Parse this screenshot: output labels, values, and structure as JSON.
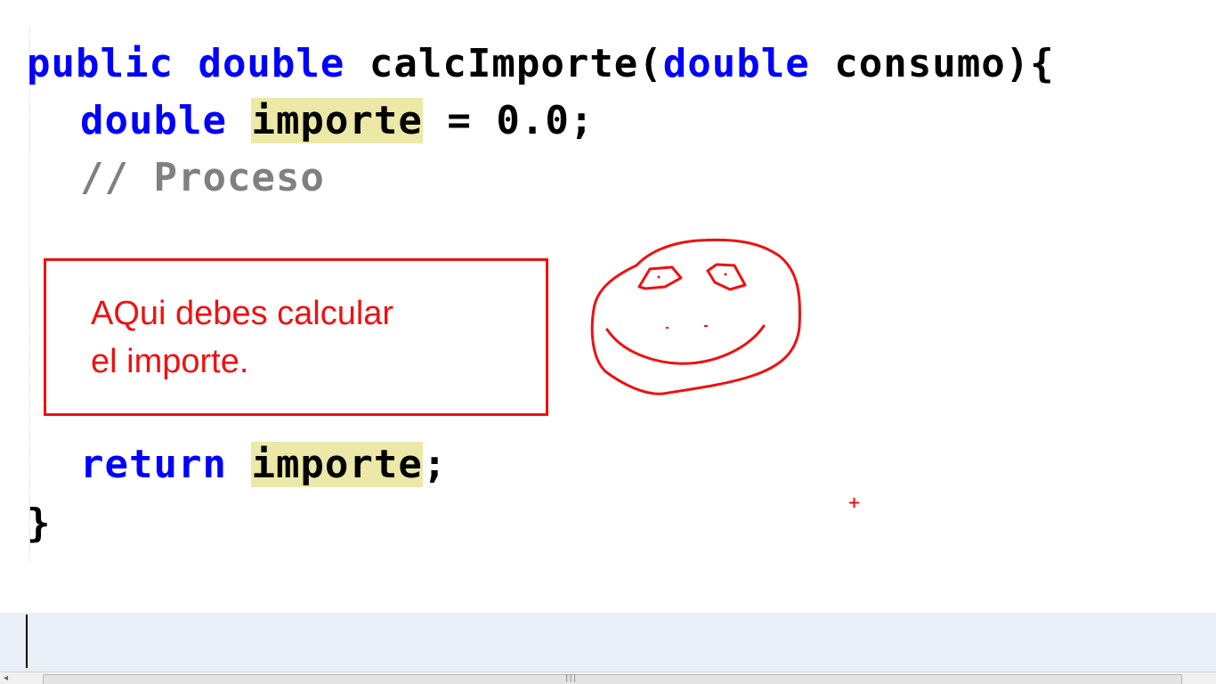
{
  "code": {
    "line1": {
      "kw_public": "public",
      "kw_double": "double",
      "method": "calcImporte(",
      "param_type": "double",
      "param_rest": "consumo){"
    },
    "line2": {
      "type": "double",
      "var": "importe",
      "rest": "= 0.0;"
    },
    "comment": "// Proceso",
    "return_line": {
      "kw": "return",
      "var": "importe",
      "end": ";"
    },
    "closing_brace": "}"
  },
  "annotation": {
    "note": "AQui debes calcular\nel importe."
  },
  "colors": {
    "keyword": "#0000ff",
    "comment": "#808080",
    "highlight": "#ece9a8",
    "annotation": "#ee1111",
    "current_line": "#e9eef7"
  },
  "icons": {
    "drawing": "smiley-face-drawing",
    "cursor": "crosshair-cursor-icon"
  }
}
